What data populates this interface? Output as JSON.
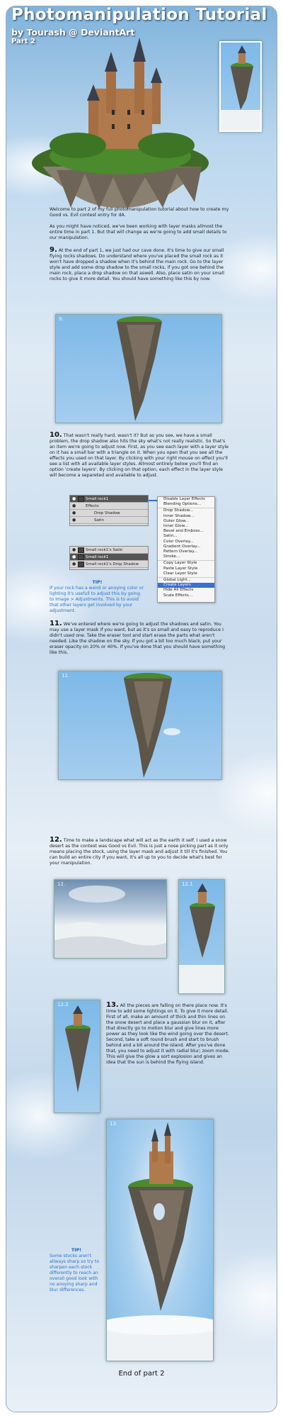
{
  "header": {
    "title": "Photomanipulation Tutorial",
    "byline": "by Tourash @ DeviantArt",
    "part": "Part 2"
  },
  "intro": {
    "p1": "Welcome to part 2 of my full photomanipulation tutorial about how to create my Good vs. Evil contest entry for dA.",
    "p2": "As you might have noticed, we've been working with layer masks allmost the entire time in part 1. But that will change as we're going to add small details to our manipulation."
  },
  "steps": [
    {
      "num": "9.",
      "text": "At the end of part 1, we just had our cave done. It's time to give our small flying rocks shadows. Do understand where you've placed the small rock as it won't have dropped a shadow when it's behind the main rock. Go to the layer style and add some drop shadow to the small rocks, if you got one behind the main rock, place a drop shadow on that aswell. Also, place satin on your small rocks to give it more detail. You should have something like this by now."
    },
    {
      "num": "10.",
      "text": "That wasn't really hard, wasn't it? But as you see, we have a small problem, the drop shadow also hits the sky what's not really realistic. So that's an item we're going to adjust now. First, as you see each layer with a layer style on it has a small bar with a triangle on it. When you open that you see all the effects you used on that layer. By clicking with your right mouse on effect you'll see a list with all available layer styles. Allmost entirely below you'll find an option 'create layers'. By clicking on that option, each effect in the layer style will become a separeted and available to adjust."
    },
    {
      "num": "11.",
      "text": "We've entered where we're going to adjust the shadows and satin. You may use a layer mask if you want, but as it's so small and easy to reproduce I didn't used one. Take the eraser tool and start erase the parts what aren't needed. Like the shadow on the sky. If you got a bit too much black, put your eraser opacity on 20% or 40%. If you've done that you should have something like this."
    },
    {
      "num": "12.",
      "text": "Time to make a landscape what will act as the earth it self. I used a snow desert as the contest was Good vs Evil. This is just a nose picking part as it only means placing the stock, using the layer mask and adjust it till it's finished. You can build an entire city if you want, it's all up to you to decide what's best for your manipulation."
    },
    {
      "num": "13.",
      "text": "All the pieces are falling on there place now. It's time to add some lightings on it. To give it more detail. First of all, make an amount of thick and thin lines on the snow desert and place a gaussian blur on it, after that directly go to motion blur and give lines more power as they look like the wind going over the desert. Second, take a soft round brush and start to brush behind and a bit around the island. After you've done that, you need to adjust it with radial blur; zoom mode. This will give the glow a sort explosion and gives an idea that the sun is behind the flying island."
    }
  ],
  "shots": {
    "s9": "9.",
    "s11": "11.",
    "s12": "12.",
    "s121": "12.1",
    "s122": "12.2",
    "s13": "13."
  },
  "layers_panel": {
    "rows": [
      "Small rock1",
      "Effects",
      "Drop Shadow",
      "Satin"
    ],
    "rows2": [
      "Small rock1's Satin",
      "Small rock1",
      "Small rock1's Drop Shadow"
    ]
  },
  "context_menu": {
    "items": [
      "Disable Layer Effects",
      "Blending Options...",
      "Drop Shadow...",
      "Inner Shadow...",
      "Outer Glow...",
      "Inner Glow...",
      "Bevel and Emboss...",
      "Satin...",
      "Color Overlay...",
      "Gradient Overlay...",
      "Pattern Overlay...",
      "Stroke...",
      "Copy Layer Style",
      "Paste Layer Style",
      "Clear Layer Style",
      "Global Light...",
      "Create Layers",
      "Hide All Effects",
      "Scale Effects..."
    ],
    "selected": "Create Layers"
  },
  "tip1": {
    "head": "TIP!",
    "body": "If your rock has a weird or anoying color or lighting it's usefull to adjust this by going to Image > Adjustments. This is to avoid that other layers get involved by your adjustment."
  },
  "tip2": {
    "head": "TIP!",
    "body": "Some stocks aren't allways sharp so try to sharpen each stock differently to reach an overall good look with no anoying sharp and blur differences."
  },
  "footer": {
    "end": "End of part 2"
  },
  "colors": {
    "accent": "#2a74c8",
    "sky": "#7db9e8"
  }
}
